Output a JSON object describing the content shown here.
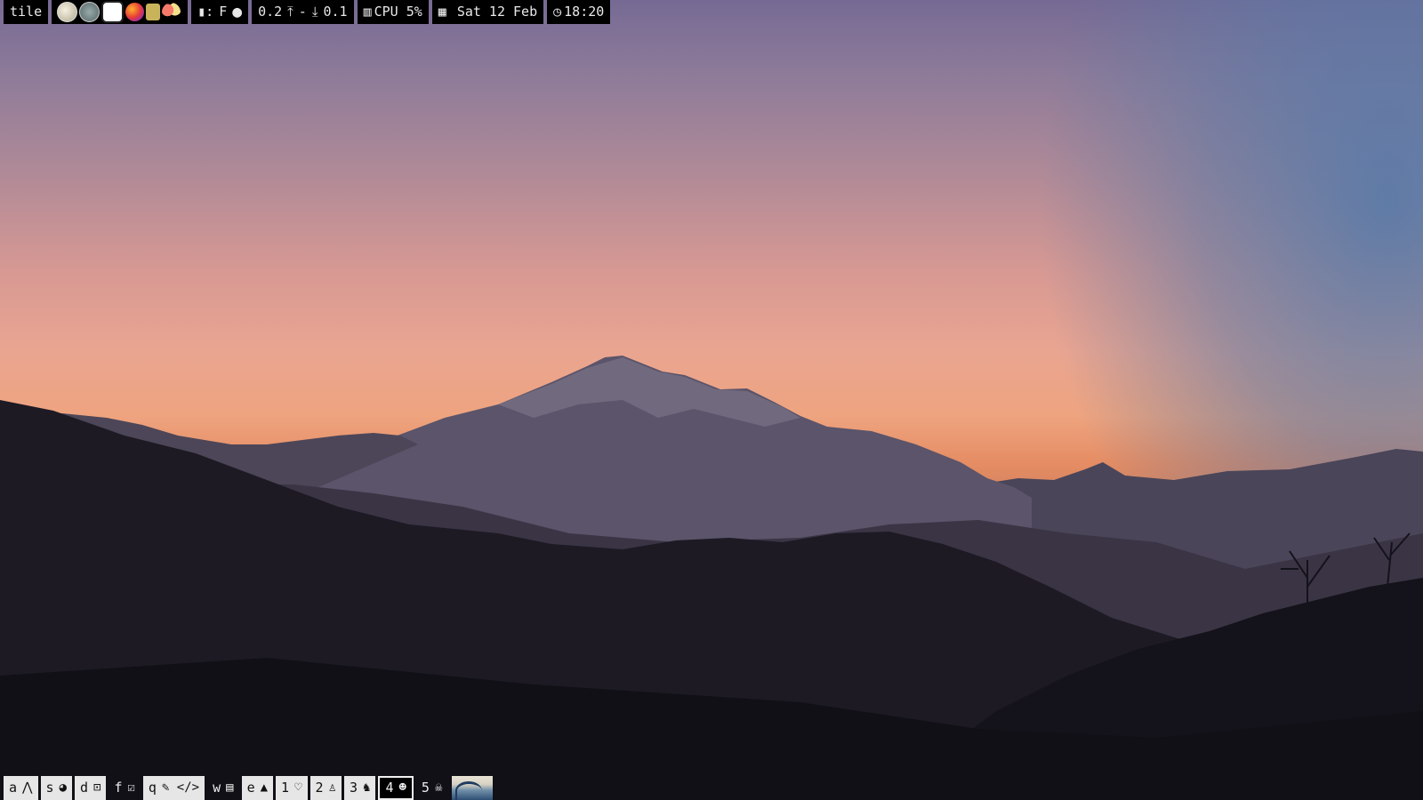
{
  "colors": {
    "bar_bg": "#000000",
    "bar_fg": "#e8e8e8",
    "ws_bg": "#e6e6e6",
    "ws_fg": "#111111"
  },
  "topbar": {
    "layout": "tile",
    "tray_icons": [
      "tray-globe-icon",
      "tray-network-icon",
      "tray-chat-icon",
      "tray-firefox-icon",
      "tray-clipboard-icon",
      "tray-balloons-icon"
    ],
    "battery_prefix": "▮:",
    "battery_status": "F",
    "record_icon": "●",
    "net_up": "0.2",
    "net_up_icon": "⤒",
    "net_sep": "-",
    "net_down_icon": "⤓",
    "net_down": "0.1",
    "cpu_icon": "▥",
    "cpu": "CPU 5%",
    "calendar_icon": "▦",
    "date": "Sat 12 Feb",
    "clock_icon": "◷",
    "time": "18:20"
  },
  "workspaces": [
    {
      "key": "a",
      "icon": "arch-icon",
      "glyph": "⋀",
      "state": "normal"
    },
    {
      "key": "s",
      "icon": "firefox-icon",
      "glyph": "◕",
      "state": "normal"
    },
    {
      "key": "d",
      "icon": "terminal-icon",
      "glyph": "⊡",
      "state": "normal"
    },
    {
      "key": "f",
      "icon": "check-box-icon",
      "glyph": "☑",
      "state": "dim"
    },
    {
      "key": "q",
      "icon": "code-icon",
      "glyph": "✎ </>",
      "state": "normal"
    },
    {
      "key": "w",
      "icon": "book-icon",
      "glyph": "▤",
      "state": "dim"
    },
    {
      "key": "e",
      "icon": "chart-icon",
      "glyph": "▲",
      "state": "normal"
    },
    {
      "key": "1",
      "icon": "heart-icon",
      "glyph": "♡",
      "state": "normal"
    },
    {
      "key": "2",
      "icon": "linux-icon",
      "glyph": "♙",
      "state": "normal"
    },
    {
      "key": "3",
      "icon": "cat-icon",
      "glyph": "♞",
      "state": "normal"
    },
    {
      "key": "4",
      "icon": "alien-icon",
      "glyph": "☻",
      "state": "active"
    },
    {
      "key": "5",
      "icon": "skull-icon",
      "glyph": "☠",
      "state": "dim"
    }
  ]
}
